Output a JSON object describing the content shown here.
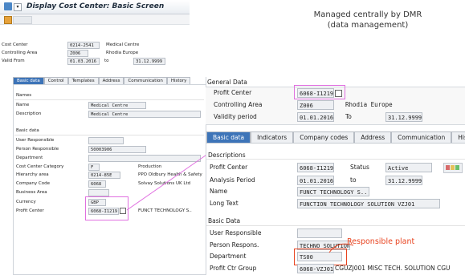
{
  "window": {
    "title": "Display Cost Center: Basic Screen"
  },
  "annotations": {
    "top_note": "Managed centrally by DMR (data management)",
    "responsible_plant": "Responsible plant"
  },
  "left_header": {
    "cost_center_label": "Cost Center",
    "cost_center_value": "0214-2541",
    "cost_center_desc": "Medical Centre",
    "controlling_area_label": "Controlling Area",
    "controlling_area_value": "Z006",
    "controlling_area_desc": "Rhodia Europe",
    "valid_from_label": "Valid From",
    "valid_from_value": "01.03.2016",
    "to_label": "to",
    "valid_to_value": "31.12.9999"
  },
  "left_tabs": [
    "Basic data",
    "Control",
    "Templates",
    "Address",
    "Communication",
    "History"
  ],
  "left_names": {
    "heading": "Names",
    "name_label": "Name",
    "name_value": "Medical Centre",
    "desc_label": "Description",
    "desc_value": "Medical Centre"
  },
  "left_basic": {
    "heading": "Basic data",
    "user_resp_label": "User Responsible",
    "person_resp_label": "Person Responsible",
    "person_resp_value": "50003906",
    "department_label": "Department",
    "category_label": "Cost Center Category",
    "category_value": "F",
    "category_desc": "Production",
    "hierarchy_label": "Hierarchy area",
    "hierarchy_value": "0214-85E",
    "hierarchy_desc": "PPO Oldbury Health & Safety",
    "company_label": "Company Code",
    "company_value": "6068",
    "company_desc": "Solvay Solutions UK Ltd",
    "business_label": "Business Area",
    "currency_label": "Currency",
    "currency_value": "GBP",
    "profit_label": "Profit Center",
    "profit_value": "6068-I1219",
    "profit_desc": "FUNCT TECHNOLOGY S.."
  },
  "right_general": {
    "heading": "General Data",
    "profit_label": "Profit Center",
    "profit_value": "6068-I1219",
    "ca_label": "Controlling Area",
    "ca_value": "Z006",
    "ca_desc": "Rhodia Europe",
    "validity_label": "Validity period",
    "validity_from": "01.01.2016",
    "to_label": "To",
    "validity_to": "31.12.9999"
  },
  "right_tabs": [
    "Basic data",
    "Indicators",
    "Company codes",
    "Address",
    "Communication",
    "History"
  ],
  "right_desc": {
    "heading": "Descriptions",
    "pc_label": "Profit Center",
    "pc_value": "6068-I1219",
    "status_label": "Status",
    "status_value": "Active",
    "period_label": "Analysis Period",
    "period_from": "01.01.2016",
    "to_label": "to",
    "period_to": "31.12.9999",
    "name_label": "Name",
    "name_value": "FUNCT TECHNOLOGY S..",
    "long_label": "Long Text",
    "long_value": "FUNCTION TECHNOLOGY SOLUTION VZJ01"
  },
  "right_basic": {
    "heading": "Basic Data",
    "user_label": "User Responsible",
    "person_label": "Person Respons.",
    "person_value": "TECHNO SOLUTIONS",
    "dept_label": "Department",
    "dept_value": "TS00",
    "group_label": "Profit Ctr Group",
    "group_value": "6068-VZJ01",
    "group_desc": "CGUZJ001 MISC TECH. SOLUTION CGU"
  },
  "colors": {
    "tab_active": "#3d74b8",
    "highlight": "#e070e0",
    "annotation_red": "#e8431f"
  }
}
